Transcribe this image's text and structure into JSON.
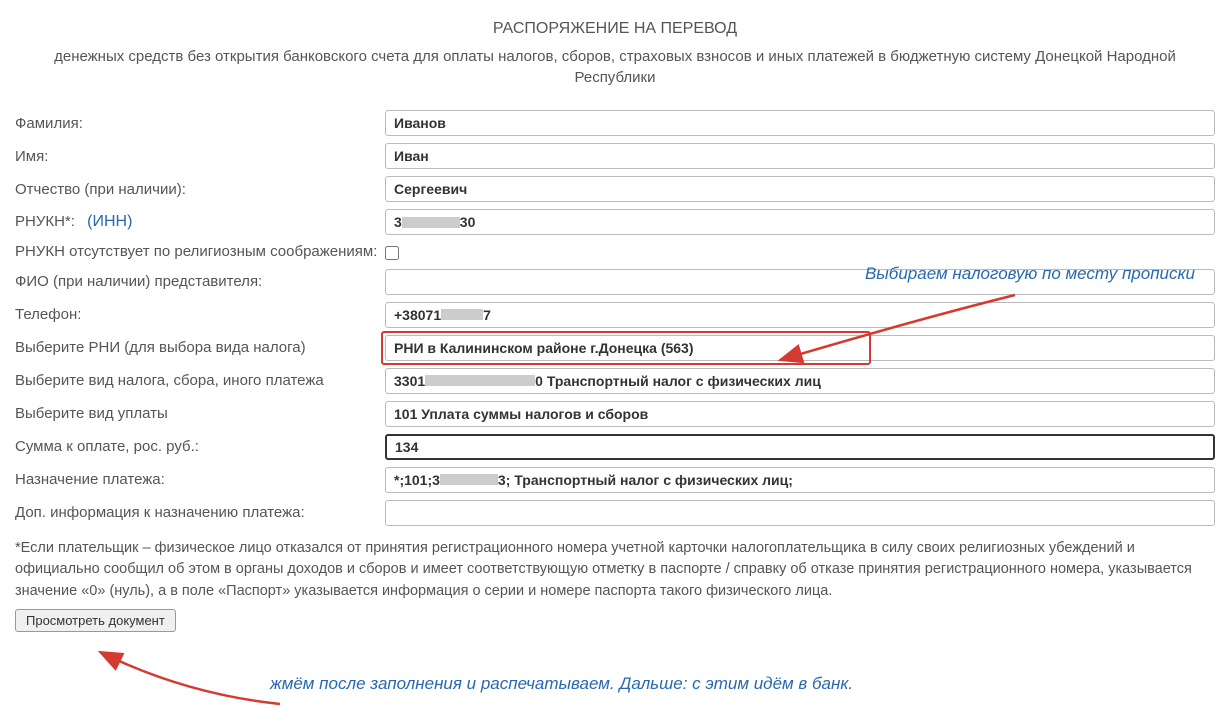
{
  "header": {
    "title": "РАСПОРЯЖЕНИЕ НА ПЕРЕВОД",
    "subtitle": "денежных средств без открытия банковского счета для оплаты налогов, сборов, страховых взносов и иных платежей в бюджетную систему Донецкой Народной Республики"
  },
  "form": {
    "surname_label": "Фамилия:",
    "surname_value": "Иванов",
    "name_label": "Имя:",
    "name_value": "Иван",
    "patronymic_label": "Отчество (при наличии):",
    "patronymic_value": "Сергеевич",
    "rnukn_label": "РНУКН*:",
    "rnukn_inn": "(ИНН)",
    "rnukn_value_prefix": "3",
    "rnukn_value_suffix": "30",
    "rnukn_absent_label": "РНУКН отсутствует по религиозным соображениям:",
    "representative_label": "ФИО (при наличии) представителя:",
    "representative_value": "",
    "phone_label": "Телефон:",
    "phone_value_prefix": "+38071",
    "phone_value_suffix": "7",
    "rni_label": "Выберите РНИ (для выбора вида налога)",
    "rni_value": "РНИ в Калининском районе г.Донецка (563)",
    "tax_type_label": "Выберите вид налога, сбора, иного платежа",
    "tax_type_value_prefix": "3301",
    "tax_type_value_suffix": "0 Транспортный налог с физических лиц",
    "payment_type_label": "Выберите вид уплаты",
    "payment_type_value": "101 Уплата суммы налогов и сборов",
    "amount_label": "Сумма к оплате, рос. руб.:",
    "amount_value": "134",
    "purpose_label": "Назначение платежа:",
    "purpose_value_prefix": "*;101;3",
    "purpose_value_suffix": "3; Транспортный налог с физических лиц;",
    "additional_label": "Доп. информация к назначению платежа:",
    "additional_value": ""
  },
  "footnote": "*Если плательщик – физическое лицо отказался от принятия регистрационного номера учетной карточки налогоплательщика в силу своих религиозных убеждений и официально сообщил об этом в органы доходов и сборов и имеет соответствующую отметку в паспорте / справку об отказе принятия регистрационного номера, указывается значение «0» (нуль), а в поле «Паспорт» указывается информация о серии и номере паспорта такого физического лица.",
  "submit_label": "Просмотреть документ",
  "annotations": {
    "top": "Выбираем налоговую по месту прописки",
    "bottom": "жмём после заполнения и распечатываем. Дальше: с этим идём в банк."
  }
}
